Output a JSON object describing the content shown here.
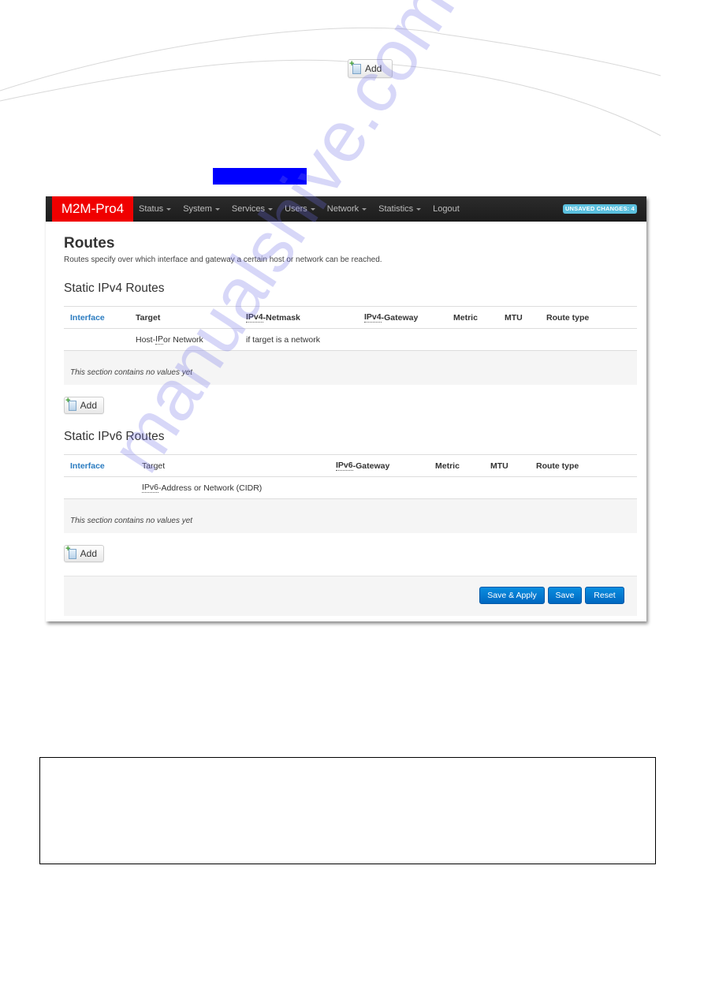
{
  "top_add_button": {
    "label": "Add",
    "icon": "add-document-icon"
  },
  "app": {
    "brand": "M2M-Pro4",
    "nav": [
      {
        "label": "Status",
        "has_dropdown": true
      },
      {
        "label": "System",
        "has_dropdown": true
      },
      {
        "label": "Services",
        "has_dropdown": true
      },
      {
        "label": "Users",
        "has_dropdown": true
      },
      {
        "label": "Network",
        "has_dropdown": true
      },
      {
        "label": "Statistics",
        "has_dropdown": true
      },
      {
        "label": "Logout",
        "has_dropdown": false
      }
    ],
    "unsaved_badge": "UNSAVED CHANGES: 4",
    "colors": {
      "brand": "#f00000",
      "navbar": "#222222",
      "badge": "#5bc0de",
      "primary_button": "#0a7fd6",
      "link": "#2a7bc0"
    }
  },
  "page": {
    "title": "Routes",
    "description": "Routes specify over which interface and gateway a certain host or network can be reached."
  },
  "ipv4": {
    "title": "Static IPv4 Routes",
    "headers": {
      "interface": "Interface",
      "target": "Target",
      "netmask_prefix": "IPv4",
      "netmask_suffix": "-Netmask",
      "gateway_prefix": "IPv4",
      "gateway_suffix": "-Gateway",
      "metric": "Metric",
      "mtu": "MTU",
      "route_type": "Route type"
    },
    "hint_row": {
      "target_prefix": "Host-",
      "target_abbr": "IP",
      "target_suffix": " or Network",
      "netmask": "if target is a network"
    },
    "empty_message": "This section contains no values yet",
    "add_label": "Add"
  },
  "ipv6": {
    "title": "Static IPv6 Routes",
    "headers": {
      "interface": "Interface",
      "target": "Target",
      "gateway_prefix": "IPv6",
      "gateway_suffix": "-Gateway",
      "metric": "Metric",
      "mtu": "MTU",
      "route_type": "Route type"
    },
    "hint_row": {
      "target_abbr": "IPv6",
      "target_suffix": "-Address or Network (CIDR)"
    },
    "empty_message": "This section contains no values yet",
    "add_label": "Add"
  },
  "actions": {
    "save_apply": "Save & Apply",
    "save": "Save",
    "reset": "Reset"
  },
  "watermark": "manualshive.com"
}
